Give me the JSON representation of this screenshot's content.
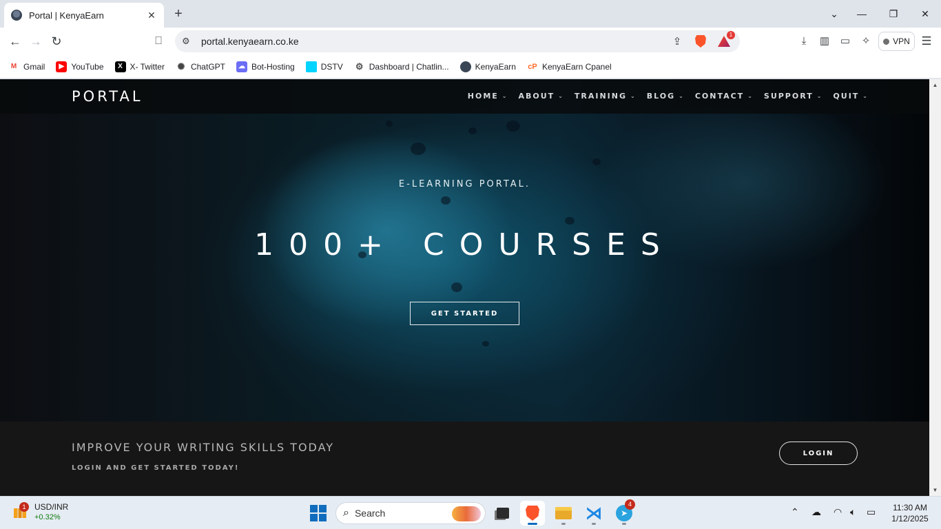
{
  "browser": {
    "tab": {
      "title": "Portal | KenyaEarn"
    },
    "address": {
      "url": "portal.kenyaearn.co.ke"
    },
    "rewards_badge": "1",
    "vpn_label": "VPN",
    "bookmarks": [
      {
        "label": "Gmail",
        "icon": "gmail-icon",
        "color": "#ea4335"
      },
      {
        "label": "YouTube",
        "icon": "youtube-icon",
        "color": "#ff0000"
      },
      {
        "label": "X- Twitter",
        "icon": "x-icon",
        "color": "#000000"
      },
      {
        "label": "ChatGPT",
        "icon": "chatgpt-icon",
        "color": "#444444"
      },
      {
        "label": "Bot-Hosting",
        "icon": "bot-hosting-icon",
        "color": "#6b6ef5"
      },
      {
        "label": "DSTV",
        "icon": "dstv-icon",
        "color": "#00d4ff"
      },
      {
        "label": "Dashboard | Chatlin...",
        "icon": "gear-icon",
        "color": "#555555"
      },
      {
        "label": "KenyaEarn",
        "icon": "kenyaearn-icon",
        "color": "#3a4656"
      },
      {
        "label": "KenyaEarn Cpanel",
        "icon": "cpanel-icon",
        "color": "#ff6c2c"
      }
    ]
  },
  "site": {
    "logo": "PORTAL",
    "nav": [
      "HOME",
      "ABOUT",
      "TRAINING",
      "BLOG",
      "CONTACT",
      "SUPPORT",
      "QUIT"
    ],
    "hero": {
      "eyebrow": "E-LEARNING PORTAL.",
      "headline": "100+ COURSES",
      "cta": "GET STARTED"
    },
    "promo": {
      "heading": "IMPROVE YOUR WRITING SKILLS TODAY",
      "subheading": "LOGIN AND GET STARTED TODAY!",
      "button": "LOGIN"
    }
  },
  "taskbar": {
    "widget": {
      "title": "USD/INR",
      "change": "+0.32%",
      "badge": "1"
    },
    "search_label": "Search",
    "telegram_badge": "4",
    "clock": {
      "time": "11:30 AM",
      "date": "1/12/2025"
    }
  }
}
